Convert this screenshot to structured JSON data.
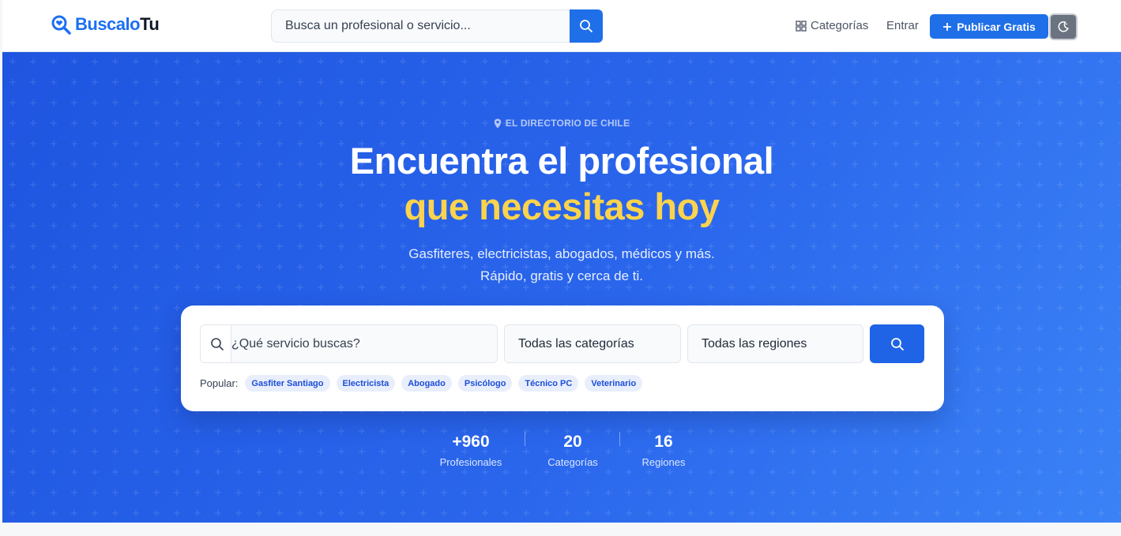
{
  "header": {
    "logo_part1": "Buscalo",
    "logo_part2": "Tu",
    "search_placeholder": "Busca un profesional o servicio...",
    "nav_categories": "Categorías",
    "nav_login": "Entrar",
    "publish_label": "Publicar Gratis"
  },
  "hero": {
    "badge": "EL DIRECTORIO DE CHILE",
    "title_line1": "Encuentra el profesional",
    "title_line2": "que necesitas hoy",
    "subtitle_line1": "Gasfiteres, electricistas, abogados, médicos y más.",
    "subtitle_line2": "Rápido, gratis y cerca de ti."
  },
  "search_card": {
    "service_placeholder": "¿Qué servicio buscas?",
    "category_select": "Todas las categorías",
    "region_select": "Todas las regiones",
    "popular_label": "Popular:",
    "popular": [
      "Gasfiter Santiago",
      "Electricista",
      "Abogado",
      "Psicólogo",
      "Técnico PC",
      "Veterinario"
    ]
  },
  "stats": [
    {
      "value": "+960",
      "label": "Profesionales"
    },
    {
      "value": "20",
      "label": "Categorías"
    },
    {
      "value": "16",
      "label": "Regiones"
    }
  ],
  "colors": {
    "brand": "#1d6ff2",
    "accent_yellow": "#fcd34d",
    "hero_start": "#1f55e0",
    "hero_end": "#3b82f6"
  },
  "icons": {
    "logo": "magnifier-heart-icon",
    "header_search": "search-icon",
    "categories": "grid-icon",
    "publish": "plus-icon",
    "theme": "moon-icon",
    "badge": "map-pin-icon"
  }
}
